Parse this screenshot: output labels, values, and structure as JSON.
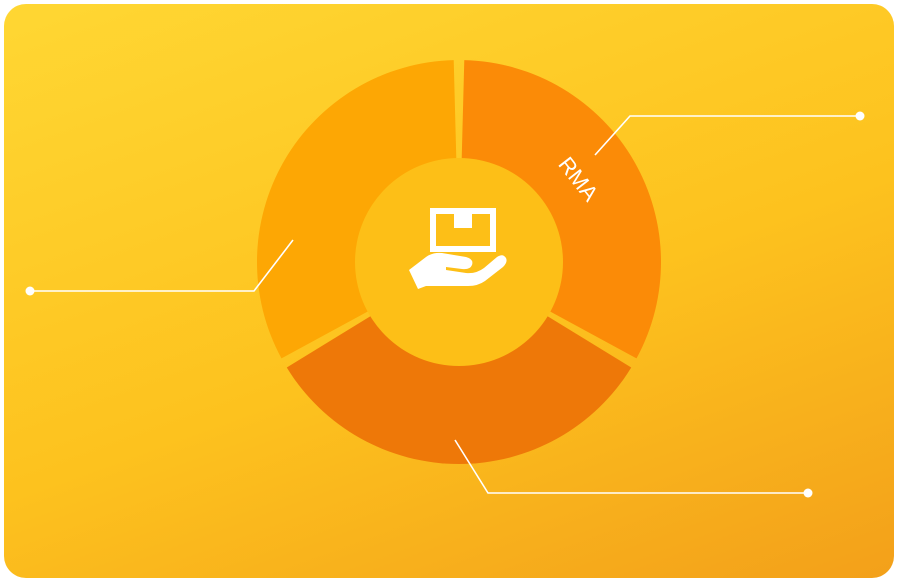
{
  "diagram": {
    "segments": [
      {
        "label": "RMA",
        "color": "#fb8b07"
      },
      {
        "label": "",
        "color": "#ee7808"
      },
      {
        "label": "",
        "color": "#fda704"
      }
    ],
    "colors": {
      "background_top": "#ffd733",
      "background_bottom": "#f3a01a",
      "ring_gap": "#fdc51f",
      "center_disc": "#fdbf17",
      "leader_line": "#ffffff",
      "icon": "#ffffff"
    },
    "center_icon": "hand-holding-box-icon"
  }
}
